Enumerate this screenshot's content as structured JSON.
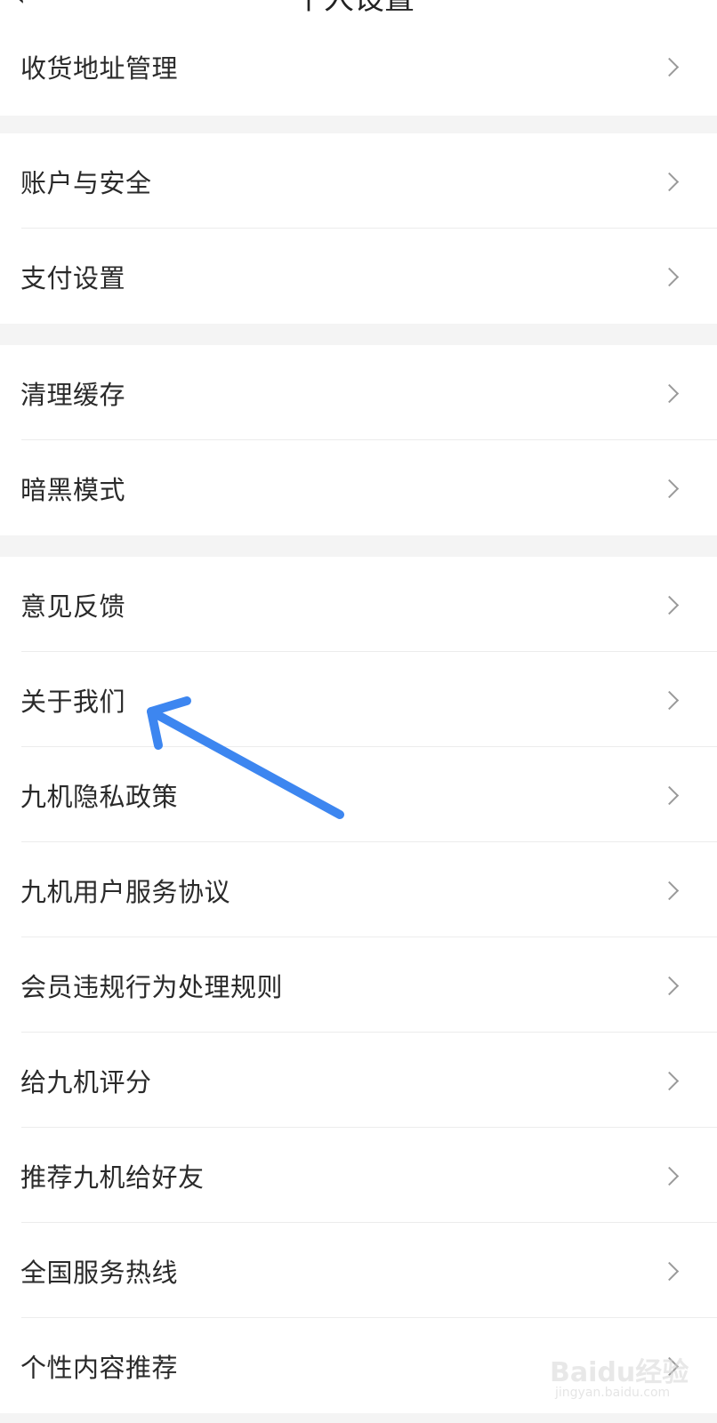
{
  "header": {
    "title": "个人设置"
  },
  "groups": [
    {
      "items": [
        {
          "label": "收货地址管理"
        }
      ]
    },
    {
      "items": [
        {
          "label": "账户与安全"
        },
        {
          "label": "支付设置"
        }
      ]
    },
    {
      "items": [
        {
          "label": "清理缓存"
        },
        {
          "label": "暗黑模式"
        }
      ]
    },
    {
      "items": [
        {
          "label": "意见反馈"
        },
        {
          "label": "关于我们"
        },
        {
          "label": "九机隐私政策"
        },
        {
          "label": "九机用户服务协议"
        },
        {
          "label": "会员违规行为处理规则"
        },
        {
          "label": "给九机评分"
        },
        {
          "label": "推荐九机给好友"
        },
        {
          "label": "全国服务热线"
        },
        {
          "label": "个性内容推荐"
        }
      ]
    }
  ],
  "annotation": {
    "color": "#3d86f0",
    "icon": "arrow-pointer-icon"
  },
  "watermark": {
    "brand": "Baidu经验",
    "url": "jingyan.baidu.com"
  }
}
